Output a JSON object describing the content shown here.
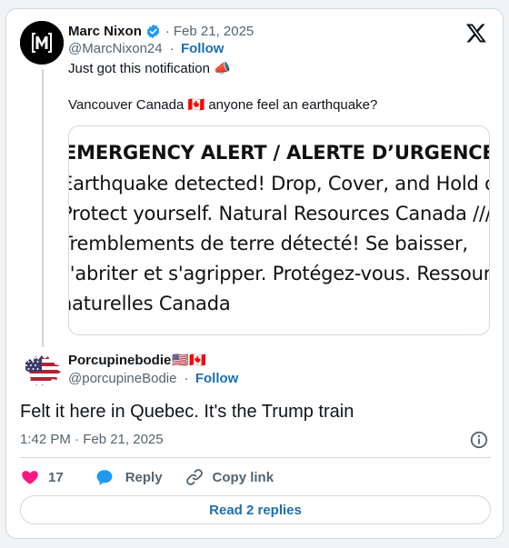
{
  "tweet": {
    "author": {
      "name": "Marc Nixon",
      "handle": "@MarcNixon24",
      "follow_label": "Follow",
      "verified_color": "#1d9bf0",
      "avatar_icon": "black-m-logo-avatar"
    },
    "date": "Feb 21, 2025",
    "separator": "·",
    "text_line1": "Just got this notification 📣",
    "text_line2": "Vancouver Canada 🇨🇦 anyone feel an earthquake?",
    "alert_image": {
      "lines": [
        "EMERGENCY ALERT / ALERTE D’URGENCE",
        "Earthquake detected! Drop, Cover, and Hold on.",
        "Protect yourself. Natural Resources Canada ///",
        "Tremblements de terre détecté! Se baisser,",
        "s'abriter et s'agripper. Protégez-vous. Ressources",
        "naturelles Canada"
      ]
    }
  },
  "reply": {
    "author": {
      "name": "Porcupinebodie",
      "flags": "🇺🇸🇨🇦",
      "handle": "@porcupineBodie",
      "follow_label": "Follow",
      "avatar_icon": "us-flag-canada-map-avatar"
    },
    "separator": "·",
    "text": "Felt it here in Quebec. It's the Trump train",
    "timestamp": "1:42 PM · Feb 21, 2025"
  },
  "actions": {
    "like_count": "17",
    "reply_label": "Reply",
    "copy_link_label": "Copy link",
    "read_replies_label": "Read 2 replies"
  },
  "colors": {
    "link_blue": "#1d6fb0",
    "like_pink": "#f91880",
    "reply_blue": "#1d9bf0",
    "muted": "#536471",
    "border": "#cfd9de"
  },
  "icons": [
    "x-logo-icon",
    "verified-badge-icon",
    "info-icon",
    "heart-icon",
    "reply-bubble-icon",
    "link-icon"
  ]
}
